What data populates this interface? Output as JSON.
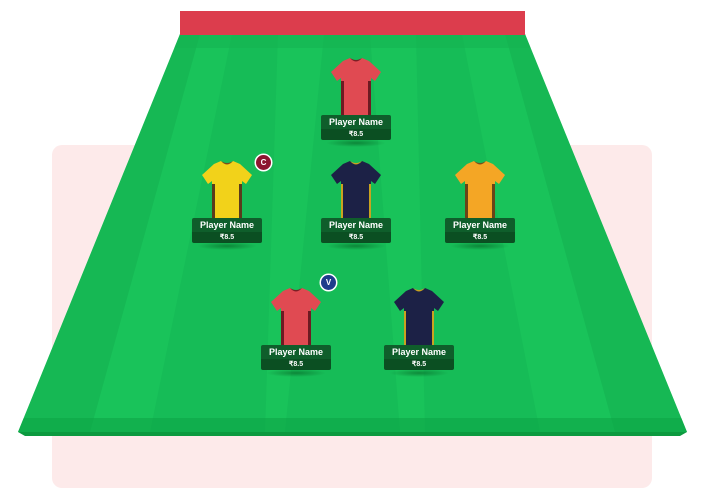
{
  "pitch": {
    "colors": {
      "grass_light": "#19c35a",
      "grass_dark": "#10a848",
      "edge": "#0c9a3f",
      "goal_bar": "#dc3d4d",
      "backdrop": "#fdeaea"
    }
  },
  "players": [
    {
      "name": "Player Name",
      "price": "₹8.5",
      "jersey": "red"
    },
    {
      "name": "Player Name",
      "price": "₹8.5",
      "jersey": "yellow",
      "badge": "C"
    },
    {
      "name": "Player Name",
      "price": "₹8.5",
      "jersey": "navy"
    },
    {
      "name": "Player Name",
      "price": "₹8.5",
      "jersey": "orange"
    },
    {
      "name": "Player Name",
      "price": "₹8.5",
      "jersey": "red",
      "badge": "V"
    },
    {
      "name": "Player Name",
      "price": "₹8.5",
      "jersey": "navy"
    }
  ],
  "badges": {
    "captain": "C",
    "vice_captain": "V"
  },
  "jersey_colors": {
    "red": {
      "body": "#e04a52",
      "side": "#6e1a22",
      "collar": "#7a1f25"
    },
    "yellow": {
      "body": "#f2d21a",
      "side": "#5a3b1c",
      "collar": "#7a4e1a"
    },
    "navy": {
      "body": "#1c2146",
      "side": "#c9a320",
      "collar": "#c9a320"
    },
    "orange": {
      "body": "#f4a625",
      "side": "#6a4418",
      "collar": "#7a4e1a"
    }
  }
}
